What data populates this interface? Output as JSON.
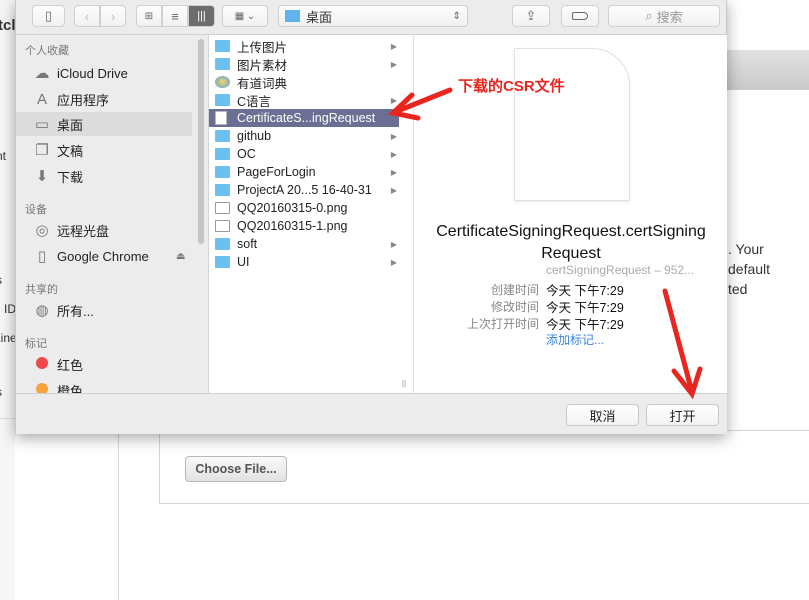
{
  "background": {
    "left_fragments": [
      "tcl",
      "nt",
      "s",
      "n ID",
      "Line",
      "s"
    ],
    "right_fragments": [
      ". Your",
      "default",
      "ted"
    ],
    "choose_file": "Choose File..."
  },
  "toolbar": {
    "location": "桌面",
    "search_placeholder": "搜索",
    "view_modes": [
      "icon",
      "list",
      "column"
    ],
    "active_view": "column"
  },
  "sidebar": {
    "sections": [
      {
        "title": "个人收藏",
        "items": [
          {
            "label": "iCloud Drive",
            "icon": "cloud-icon"
          },
          {
            "label": "应用程序",
            "icon": "applications-icon"
          },
          {
            "label": "桌面",
            "icon": "desktop-icon",
            "selected": true
          },
          {
            "label": "文稿",
            "icon": "documents-icon"
          },
          {
            "label": "下载",
            "icon": "download-icon"
          }
        ]
      },
      {
        "title": "设备",
        "items": [
          {
            "label": "远程光盘",
            "icon": "disc-icon"
          },
          {
            "label": "Google Chrome",
            "icon": "drive-icon"
          }
        ]
      },
      {
        "title": "共享的",
        "items": [
          {
            "label": "所有...",
            "icon": "network-icon"
          }
        ]
      },
      {
        "title": "标记",
        "items": [
          {
            "label": "红色",
            "color": "#f0474a"
          },
          {
            "label": "橙色",
            "color": "#f7a23a"
          }
        ]
      }
    ]
  },
  "files": [
    {
      "name": "上传图片",
      "type": "folder"
    },
    {
      "name": "图片素材",
      "type": "folder"
    },
    {
      "name": "有道词典",
      "type": "app"
    },
    {
      "name": "C语言",
      "type": "folder"
    },
    {
      "name": "CertificateS...ingRequest",
      "type": "doc",
      "selected": true
    },
    {
      "name": "github",
      "type": "folder"
    },
    {
      "name": "OC",
      "type": "folder"
    },
    {
      "name": "PageForLogin",
      "type": "folder"
    },
    {
      "name": "ProjectA 20...5 16-40-31",
      "type": "folder"
    },
    {
      "name": "QQ20160315-0.png",
      "type": "image"
    },
    {
      "name": "QQ20160315-1.png",
      "type": "image"
    },
    {
      "name": "soft",
      "type": "folder"
    },
    {
      "name": "UI",
      "type": "folder"
    }
  ],
  "preview": {
    "filename_line1": "CertificateSigningRequest.certSigning",
    "filename_line2": "Request",
    "kind": "certSigningRequest – 952...",
    "created_label": "创建时间",
    "created": "今天 下午7:29",
    "modified_label": "修改时间",
    "modified": "今天 下午7:29",
    "opened_label": "上次打开时间",
    "opened": "今天 下午7:29",
    "add_tags": "添加标记..."
  },
  "footer": {
    "cancel": "取消",
    "open": "打开"
  },
  "annotation": {
    "text": "下载的CSR文件",
    "color": "#e8251f"
  }
}
